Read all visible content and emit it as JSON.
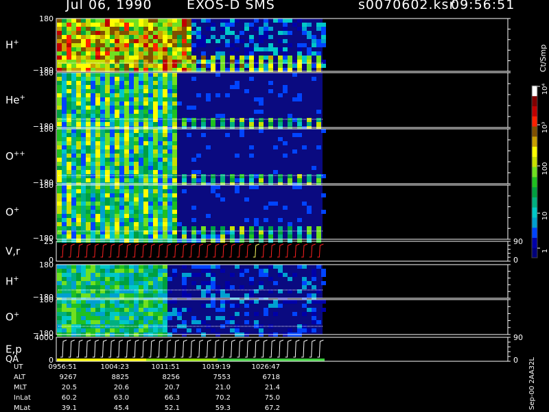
{
  "header": {
    "date": "Jul 06, 1990",
    "instrument": "EXOS-D SMS",
    "file": "s0070602.ksr",
    "time": "09:56:51"
  },
  "chart_data": {
    "type": "heatmap",
    "panels": [
      {
        "label": "H",
        "sup": "+",
        "ymax": "180",
        "ymin": "−180"
      },
      {
        "label": "He",
        "sup": "+",
        "ymax": "180",
        "ymin": "−180"
      },
      {
        "label": "O",
        "sup": "++",
        "ymax": "180",
        "ymin": "−180"
      },
      {
        "label": "O",
        "sup": "+",
        "ymax": "180",
        "ymin": "−180"
      },
      {
        "label": "V,r",
        "sup": "",
        "ymax": "25",
        "ymin": "0",
        "right_top": "90",
        "right_bottom": "0"
      },
      {
        "label": "H",
        "sup": "+",
        "ymax": "180",
        "ymin": "−180"
      },
      {
        "label": "O",
        "sup": "+",
        "ymax": "180",
        "ymin": "−180"
      },
      {
        "label": "E,p",
        "sub_label": "QA",
        "sup": "",
        "ymax": "4000",
        "ymin": "0",
        "right_top": "90",
        "right_bottom": "0"
      }
    ],
    "colorbar": {
      "title": "Ct/Smp",
      "ticks": [
        "1",
        "10",
        "100",
        "10³",
        "10⁴"
      ],
      "colors": [
        "#00007a",
        "#0000a8",
        "#0044ff",
        "#00a0d0",
        "#00c8c8",
        "#00b080",
        "#00a040",
        "#20c020",
        "#70e020",
        "#c8e000",
        "#ffff00",
        "#c8a000",
        "#805000",
        "#ff2000",
        "#c00000",
        "#800000",
        "#ffffff"
      ]
    }
  },
  "footer": {
    "labels": [
      "UT",
      "ALT",
      "MLT",
      "InLat",
      "MLat"
    ],
    "columns": [
      [
        "0956:51",
        "9267",
        "20.5",
        "60.2",
        "39.1"
      ],
      [
        "1004:23",
        "8825",
        "20.6",
        "63.0",
        "45.4"
      ],
      [
        "1011:51",
        "8256",
        "20.7",
        "66.3",
        "52.1"
      ],
      [
        "1019:19",
        "7553",
        "21.0",
        "70.2",
        "59.3"
      ],
      [
        "1026:47",
        "6718",
        "21.4",
        "75.0",
        "67.2"
      ]
    ]
  },
  "side_text": "Sep-00  2AA32L"
}
